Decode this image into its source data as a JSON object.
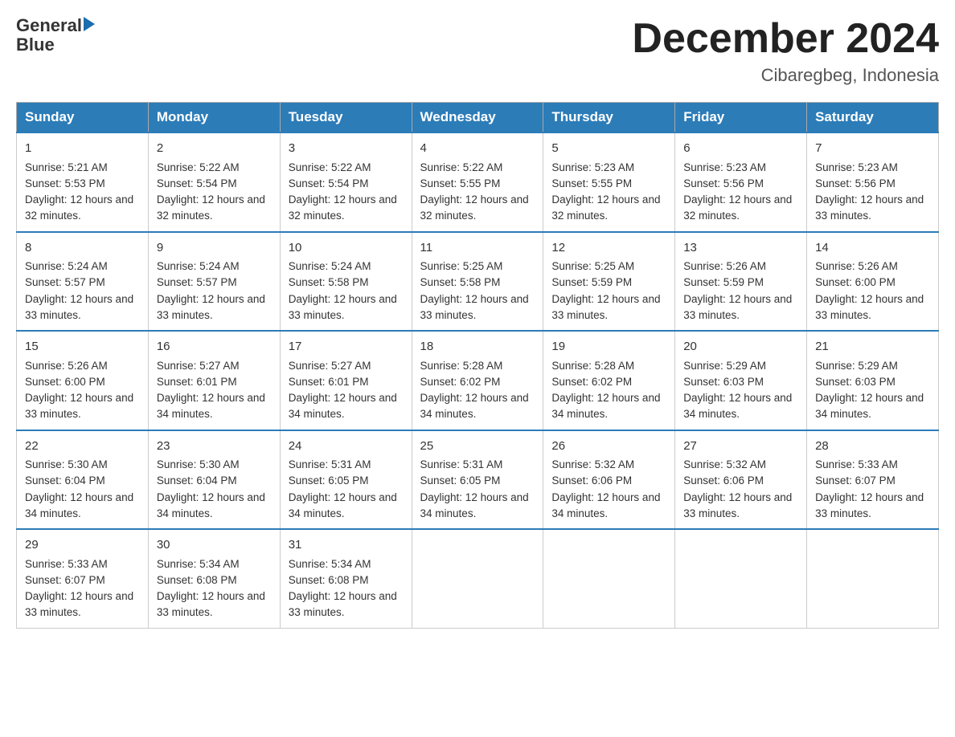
{
  "header": {
    "logo_text_general": "General",
    "logo_text_blue": "Blue",
    "month_title": "December 2024",
    "location": "Cibaregbeg, Indonesia"
  },
  "days_of_week": [
    "Sunday",
    "Monday",
    "Tuesday",
    "Wednesday",
    "Thursday",
    "Friday",
    "Saturday"
  ],
  "weeks": [
    [
      {
        "day": "1",
        "sunrise": "5:21 AM",
        "sunset": "5:53 PM",
        "daylight": "12 hours and 32 minutes."
      },
      {
        "day": "2",
        "sunrise": "5:22 AM",
        "sunset": "5:54 PM",
        "daylight": "12 hours and 32 minutes."
      },
      {
        "day": "3",
        "sunrise": "5:22 AM",
        "sunset": "5:54 PM",
        "daylight": "12 hours and 32 minutes."
      },
      {
        "day": "4",
        "sunrise": "5:22 AM",
        "sunset": "5:55 PM",
        "daylight": "12 hours and 32 minutes."
      },
      {
        "day": "5",
        "sunrise": "5:23 AM",
        "sunset": "5:55 PM",
        "daylight": "12 hours and 32 minutes."
      },
      {
        "day": "6",
        "sunrise": "5:23 AM",
        "sunset": "5:56 PM",
        "daylight": "12 hours and 32 minutes."
      },
      {
        "day": "7",
        "sunrise": "5:23 AM",
        "sunset": "5:56 PM",
        "daylight": "12 hours and 33 minutes."
      }
    ],
    [
      {
        "day": "8",
        "sunrise": "5:24 AM",
        "sunset": "5:57 PM",
        "daylight": "12 hours and 33 minutes."
      },
      {
        "day": "9",
        "sunrise": "5:24 AM",
        "sunset": "5:57 PM",
        "daylight": "12 hours and 33 minutes."
      },
      {
        "day": "10",
        "sunrise": "5:24 AM",
        "sunset": "5:58 PM",
        "daylight": "12 hours and 33 minutes."
      },
      {
        "day": "11",
        "sunrise": "5:25 AM",
        "sunset": "5:58 PM",
        "daylight": "12 hours and 33 minutes."
      },
      {
        "day": "12",
        "sunrise": "5:25 AM",
        "sunset": "5:59 PM",
        "daylight": "12 hours and 33 minutes."
      },
      {
        "day": "13",
        "sunrise": "5:26 AM",
        "sunset": "5:59 PM",
        "daylight": "12 hours and 33 minutes."
      },
      {
        "day": "14",
        "sunrise": "5:26 AM",
        "sunset": "6:00 PM",
        "daylight": "12 hours and 33 minutes."
      }
    ],
    [
      {
        "day": "15",
        "sunrise": "5:26 AM",
        "sunset": "6:00 PM",
        "daylight": "12 hours and 33 minutes."
      },
      {
        "day": "16",
        "sunrise": "5:27 AM",
        "sunset": "6:01 PM",
        "daylight": "12 hours and 34 minutes."
      },
      {
        "day": "17",
        "sunrise": "5:27 AM",
        "sunset": "6:01 PM",
        "daylight": "12 hours and 34 minutes."
      },
      {
        "day": "18",
        "sunrise": "5:28 AM",
        "sunset": "6:02 PM",
        "daylight": "12 hours and 34 minutes."
      },
      {
        "day": "19",
        "sunrise": "5:28 AM",
        "sunset": "6:02 PM",
        "daylight": "12 hours and 34 minutes."
      },
      {
        "day": "20",
        "sunrise": "5:29 AM",
        "sunset": "6:03 PM",
        "daylight": "12 hours and 34 minutes."
      },
      {
        "day": "21",
        "sunrise": "5:29 AM",
        "sunset": "6:03 PM",
        "daylight": "12 hours and 34 minutes."
      }
    ],
    [
      {
        "day": "22",
        "sunrise": "5:30 AM",
        "sunset": "6:04 PM",
        "daylight": "12 hours and 34 minutes."
      },
      {
        "day": "23",
        "sunrise": "5:30 AM",
        "sunset": "6:04 PM",
        "daylight": "12 hours and 34 minutes."
      },
      {
        "day": "24",
        "sunrise": "5:31 AM",
        "sunset": "6:05 PM",
        "daylight": "12 hours and 34 minutes."
      },
      {
        "day": "25",
        "sunrise": "5:31 AM",
        "sunset": "6:05 PM",
        "daylight": "12 hours and 34 minutes."
      },
      {
        "day": "26",
        "sunrise": "5:32 AM",
        "sunset": "6:06 PM",
        "daylight": "12 hours and 34 minutes."
      },
      {
        "day": "27",
        "sunrise": "5:32 AM",
        "sunset": "6:06 PM",
        "daylight": "12 hours and 33 minutes."
      },
      {
        "day": "28",
        "sunrise": "5:33 AM",
        "sunset": "6:07 PM",
        "daylight": "12 hours and 33 minutes."
      }
    ],
    [
      {
        "day": "29",
        "sunrise": "5:33 AM",
        "sunset": "6:07 PM",
        "daylight": "12 hours and 33 minutes."
      },
      {
        "day": "30",
        "sunrise": "5:34 AM",
        "sunset": "6:08 PM",
        "daylight": "12 hours and 33 minutes."
      },
      {
        "day": "31",
        "sunrise": "5:34 AM",
        "sunset": "6:08 PM",
        "daylight": "12 hours and 33 minutes."
      },
      null,
      null,
      null,
      null
    ]
  ],
  "labels": {
    "sunrise": "Sunrise:",
    "sunset": "Sunset:",
    "daylight": "Daylight:"
  }
}
